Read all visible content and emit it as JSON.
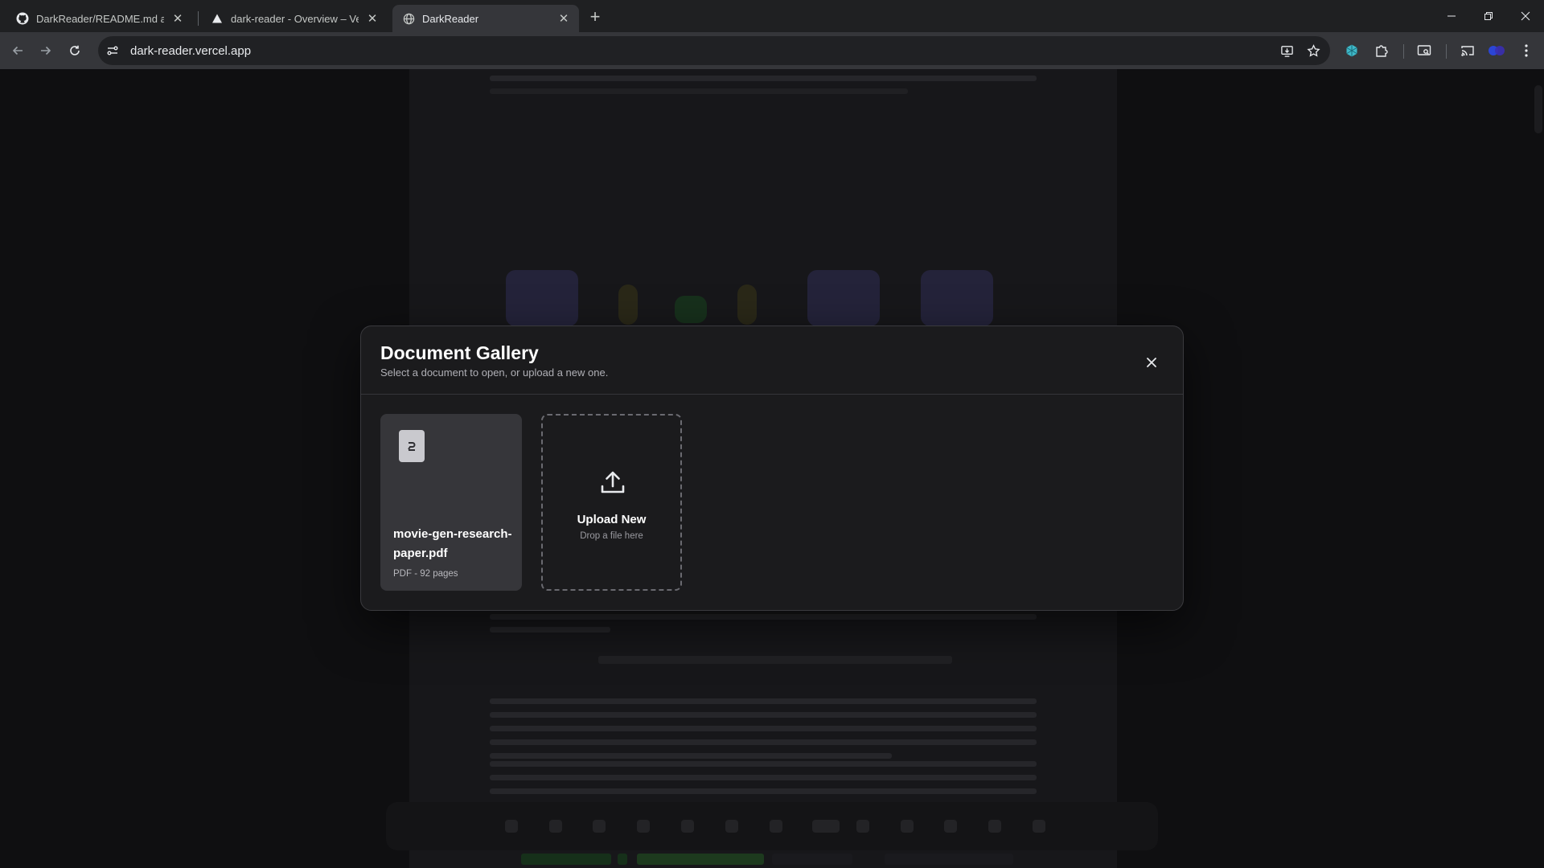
{
  "browser": {
    "tabs": [
      {
        "title": "DarkReader/README.md at ma",
        "icon": "github-icon",
        "active": false
      },
      {
        "title": "dark-reader - Overview – Vercel",
        "icon": "vercel-icon",
        "active": false
      },
      {
        "title": "DarkReader",
        "icon": "globe-icon",
        "active": true
      }
    ],
    "new_tab_symbol": "+",
    "url": "dark-reader.vercel.app"
  },
  "modal": {
    "title": "Document Gallery",
    "subtitle": "Select a document to open, or upload a new one.",
    "close_symbol": "×",
    "documents": [
      {
        "name": "movie-gen-research-paper.pdf",
        "meta": "PDF - 92 pages",
        "icon": "document-icon"
      }
    ],
    "upload": {
      "title": "Upload New",
      "hint": "Drop a file here",
      "icon": "upload-icon"
    }
  },
  "colors": {
    "background": "#0e0e10",
    "modal_bg": "#1b1b1d",
    "card_bg": "#36363a",
    "accent_green": "#2e6b2a"
  }
}
